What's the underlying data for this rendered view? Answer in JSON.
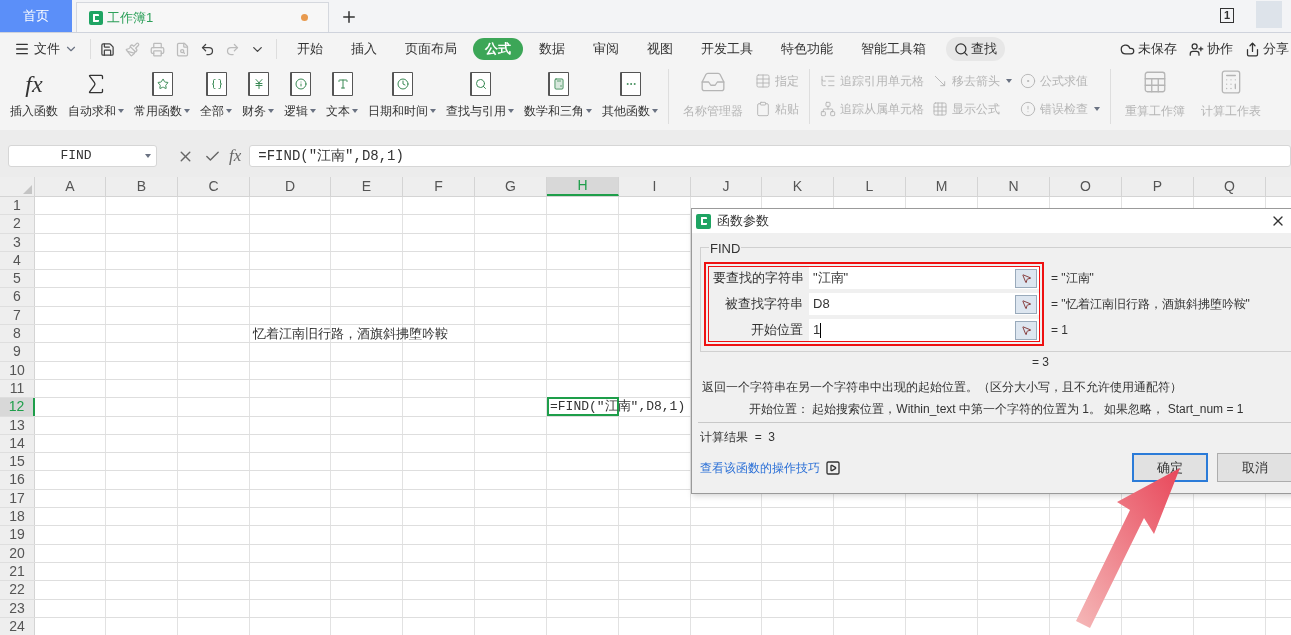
{
  "top_tabs": [
    {
      "label": "首页",
      "selected": false,
      "kind": "home"
    },
    {
      "label": "工作簿1",
      "selected": true,
      "kind": "document",
      "unsaved": true
    }
  ],
  "window_count": "1",
  "menu": {
    "file": "文件",
    "quick_access": [
      {
        "disabled": false
      },
      {
        "disabled": true
      },
      {
        "disabled": true
      },
      {
        "disabled": true
      },
      {
        "disabled": false
      },
      {
        "disabled": true
      },
      {
        "disabled": false
      }
    ],
    "tabs": [
      {
        "label": "开始",
        "selected": false
      },
      {
        "label": "插入",
        "selected": false
      },
      {
        "label": "页面布局",
        "selected": false
      },
      {
        "label": "公式",
        "selected": true
      },
      {
        "label": "数据",
        "selected": false
      },
      {
        "label": "审阅",
        "selected": false
      },
      {
        "label": "视图",
        "selected": false
      },
      {
        "label": "开发工具",
        "selected": false
      },
      {
        "label": "特色功能",
        "selected": false
      },
      {
        "label": "智能工具箱",
        "selected": false
      }
    ],
    "search": "查找",
    "actions": [
      "未保存",
      "协作",
      "分享"
    ]
  },
  "ribbon": {
    "function_items": [
      {
        "label": "插入函数",
        "dropdown": false,
        "kind": "glyph",
        "glyph": "fx"
      },
      {
        "label": "自动求和",
        "dropdown": true,
        "kind": "sigma"
      },
      {
        "label": "常用函数",
        "dropdown": true,
        "kind": "book"
      },
      {
        "label": "全部",
        "dropdown": true,
        "kind": "book"
      },
      {
        "label": "财务",
        "dropdown": true,
        "kind": "book"
      },
      {
        "label": "逻辑",
        "dropdown": true,
        "kind": "book"
      },
      {
        "label": "文本",
        "dropdown": true,
        "kind": "book"
      },
      {
        "label": "日期和时间",
        "dropdown": true,
        "kind": "book"
      },
      {
        "label": "查找与引用",
        "dropdown": true,
        "kind": "book"
      },
      {
        "label": "数学和三角",
        "dropdown": true,
        "kind": "book"
      },
      {
        "label": "其他函数",
        "dropdown": true,
        "kind": "book"
      }
    ],
    "tool_groups": [
      [
        {
          "kind": "large",
          "items": [
            {
              "label": "名称管理器",
              "dropdown": false,
              "disabled": true
            }
          ]
        },
        {
          "kind": "small",
          "items": [
            {
              "label": "指定",
              "dropdown": false,
              "disabled": true
            },
            {
              "label": "粘贴",
              "dropdown": false,
              "disabled": true
            }
          ]
        }
      ],
      [
        {
          "kind": "small",
          "items": [
            {
              "label": "追踪引用单元格",
              "dropdown": false,
              "disabled": true
            },
            {
              "label": "追踪从属单元格",
              "dropdown": false,
              "disabled": true
            }
          ]
        },
        {
          "kind": "small",
          "items": [
            {
              "label": "移去箭头",
              "dropdown": true,
              "disabled": true
            },
            {
              "label": "显示公式",
              "dropdown": false,
              "disabled": true
            }
          ]
        },
        {
          "kind": "small",
          "items": [
            {
              "label": "公式求值",
              "dropdown": false,
              "disabled": true
            },
            {
              "label": "错误检查",
              "dropdown": true,
              "disabled": true
            }
          ]
        }
      ],
      [
        {
          "kind": "large",
          "items": [
            {
              "label": "重算工作簿",
              "dropdown": false,
              "disabled": true
            }
          ]
        },
        {
          "kind": "large",
          "items": [
            {
              "label": "计算工作表",
              "dropdown": false,
              "disabled": true
            }
          ]
        }
      ]
    ]
  },
  "formula_bar": {
    "name_box": "FIND",
    "fx_glyph": "fx",
    "formula": "=FIND(″江南″,D8,1)"
  },
  "sheet": {
    "columns": [
      {
        "label": "A",
        "selected": false
      },
      {
        "label": "B",
        "selected": false
      },
      {
        "label": "C",
        "selected": false
      },
      {
        "label": "D",
        "selected": false
      },
      {
        "label": "E",
        "selected": false
      },
      {
        "label": "F",
        "selected": false
      },
      {
        "label": "G",
        "selected": false
      },
      {
        "label": "H",
        "selected": true
      },
      {
        "label": "I",
        "selected": false
      },
      {
        "label": "J",
        "selected": false
      },
      {
        "label": "K",
        "selected": false
      },
      {
        "label": "L",
        "selected": false
      },
      {
        "label": "M",
        "selected": false
      },
      {
        "label": "N",
        "selected": false
      },
      {
        "label": "O",
        "selected": false
      },
      {
        "label": "P",
        "selected": false
      },
      {
        "label": "Q",
        "selected": false
      }
    ],
    "rows": [
      {
        "label": "1",
        "selected": false
      },
      {
        "label": "2",
        "selected": false
      },
      {
        "label": "3",
        "selected": false
      },
      {
        "label": "4",
        "selected": false
      },
      {
        "label": "5",
        "selected": false
      },
      {
        "label": "6",
        "selected": false
      },
      {
        "label": "7",
        "selected": false
      },
      {
        "label": "8",
        "selected": false,
        "cells": [
          {
            "selected": false
          },
          {
            "selected": false
          },
          {
            "selected": false
          },
          {
            "text": "忆着江南旧行路，酒旗斜拂堕吟鞍",
            "selected": false
          }
        ]
      },
      {
        "label": "9",
        "selected": false
      },
      {
        "label": "10",
        "selected": false
      },
      {
        "label": "11",
        "selected": false
      },
      {
        "label": "12",
        "selected": true,
        "cells": [
          {
            "selected": false
          },
          {
            "selected": false
          },
          {
            "selected": false
          },
          {
            "selected": false
          },
          {
            "selected": false
          },
          {
            "selected": false
          },
          {
            "selected": false
          },
          {
            "text": "=FIND(″江南″,D8,1)",
            "selected": true
          }
        ]
      },
      {
        "label": "13",
        "selected": false
      },
      {
        "label": "14",
        "selected": false
      },
      {
        "label": "15",
        "selected": false
      },
      {
        "label": "16",
        "selected": false
      },
      {
        "label": "17",
        "selected": false
      },
      {
        "label": "18",
        "selected": false
      },
      {
        "label": "19",
        "selected": false
      },
      {
        "label": "20",
        "selected": false
      },
      {
        "label": "21",
        "selected": false
      },
      {
        "label": "22",
        "selected": false
      },
      {
        "label": "23",
        "selected": false
      },
      {
        "label": "24",
        "selected": false
      }
    ]
  },
  "dialog": {
    "title": "函数参数",
    "function": "FIND",
    "arguments": [
      {
        "label": "要查找的字符串",
        "value": "\"江南\"",
        "result": "= \"江南\"",
        "focused": false
      },
      {
        "label": "被查找字符串",
        "value": "D8",
        "result": "= \"忆着江南旧行路，酒旗斜拂堕吟鞍\"",
        "focused": false
      },
      {
        "label": "开始位置",
        "value": "1",
        "result": "= 1",
        "focused": true
      }
    ],
    "formula_result": "= 3",
    "description": "返回一个字符串在另一个字符串中出现的起始位置。（区分大小写，且不允许使用通配符）",
    "argument_help": "开始位置：  起始搜索位置，Within_text 中第一个字符的位置为 1。 如果忽略， Start_num = 1",
    "calc_result": "计算结果  =  3",
    "help_link": "查看该函数的操作技巧",
    "buttons": [
      {
        "label": "确定",
        "default": true
      },
      {
        "label": "取消",
        "default": false
      }
    ]
  }
}
